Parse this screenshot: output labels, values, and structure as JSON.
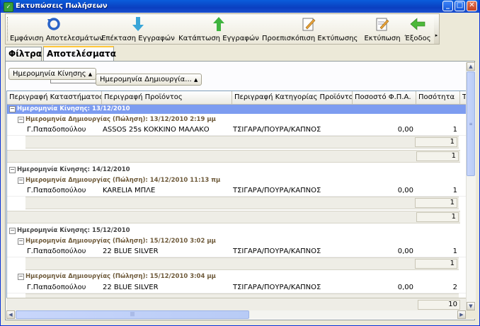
{
  "window": {
    "title": "Εκτυπώσεις Πωλήσεων"
  },
  "toolbar": {
    "items": [
      {
        "label": "Εμφάνιση Αποτελεσμάτων",
        "icon": "refresh-icon"
      },
      {
        "label": "Επέκταση Εγγραφών",
        "icon": "arrow-down-icon"
      },
      {
        "label": "Κατάπτωση Εγγραφών",
        "icon": "arrow-up-icon"
      },
      {
        "label": "Προεπισκόπιση Εκτύπωσης",
        "icon": "print-preview-icon"
      },
      {
        "label": "Εκτύπωση",
        "icon": "print-icon"
      },
      {
        "label": "Έξοδος",
        "icon": "exit-arrow-icon"
      }
    ]
  },
  "tabs": [
    {
      "label": "Φίλτρα",
      "active": false
    },
    {
      "label": "Αποτελέσματα",
      "active": true
    }
  ],
  "grouping": {
    "level1": "Ημερομηνία Κίνησης",
    "level2": "Ημερομηνία Δημιουργία..."
  },
  "columns": [
    "Περιγραφή Καταστήματος",
    "Περιγραφή Προϊόντος",
    "Περιγραφή Κατηγορίας Προϊόντος",
    "Ποσοστό Φ.Π.Α.",
    "Ποσότητα",
    "Τι"
  ],
  "groups": [
    {
      "label": "Ημερομηνία Κίνησης: 13/12/2010",
      "selected": true,
      "subgroups": [
        {
          "label": "Ημερομηνία Δημιουργίας (Πώληση): 13/12/2010 2:19 μμ",
          "rows": [
            {
              "store": "Γ.Παπαδοπούλου",
              "product": "ASSOS 25s ΚΟΚΚΙΝΟ ΜΑΛΑΚΟ",
              "category": "ΤΣΙΓΑΡΑ/ΠΟΥΡΑ/ΚΑΠΝΟΣ",
              "vat": "0,00",
              "qty": "1"
            }
          ],
          "sum": "1"
        }
      ],
      "sum": "1"
    },
    {
      "label": "Ημερομηνία Κίνησης: 14/12/2010",
      "selected": false,
      "subgroups": [
        {
          "label": "Ημερομηνία Δημιουργίας (Πώληση): 14/12/2010 11:13 πμ",
          "rows": [
            {
              "store": "Γ.Παπαδοπούλου",
              "product": "KARELIA ΜΠΛΕ",
              "category": "ΤΣΙΓΑΡΑ/ΠΟΥΡΑ/ΚΑΠΝΟΣ",
              "vat": "0,00",
              "qty": "1"
            }
          ],
          "sum": "1"
        }
      ],
      "sum": "1"
    },
    {
      "label": "Ημερομηνία Κίνησης: 15/12/2010",
      "selected": false,
      "subgroups": [
        {
          "label": "Ημερομηνία Δημιουργίας (Πώληση): 15/12/2010 3:02 μμ",
          "rows": [
            {
              "store": "Γ.Παπαδοπούλου",
              "product": "22 BLUE SILVER",
              "category": "ΤΣΙΓΑΡΑ/ΠΟΥΡΑ/ΚΑΠΝΟΣ",
              "vat": "0,00",
              "qty": "1"
            }
          ],
          "sum": "1"
        },
        {
          "label": "Ημερομηνία Δημιουργίας (Πώληση): 15/12/2010 3:04 μμ",
          "rows": [
            {
              "store": "Γ.Παπαδοπούλου",
              "product": "22 BLUE SILVER",
              "category": "ΤΣΙΓΑΡΑ/ΠΟΥΡΑ/ΚΑΠΝΟΣ",
              "vat": "0,00",
              "qty": "2"
            }
          ],
          "sum": null
        }
      ],
      "sum": null
    }
  ],
  "total": "10",
  "colors": {
    "selected_group": "#7d9cf0",
    "titlebar": "#0a5ddb"
  }
}
